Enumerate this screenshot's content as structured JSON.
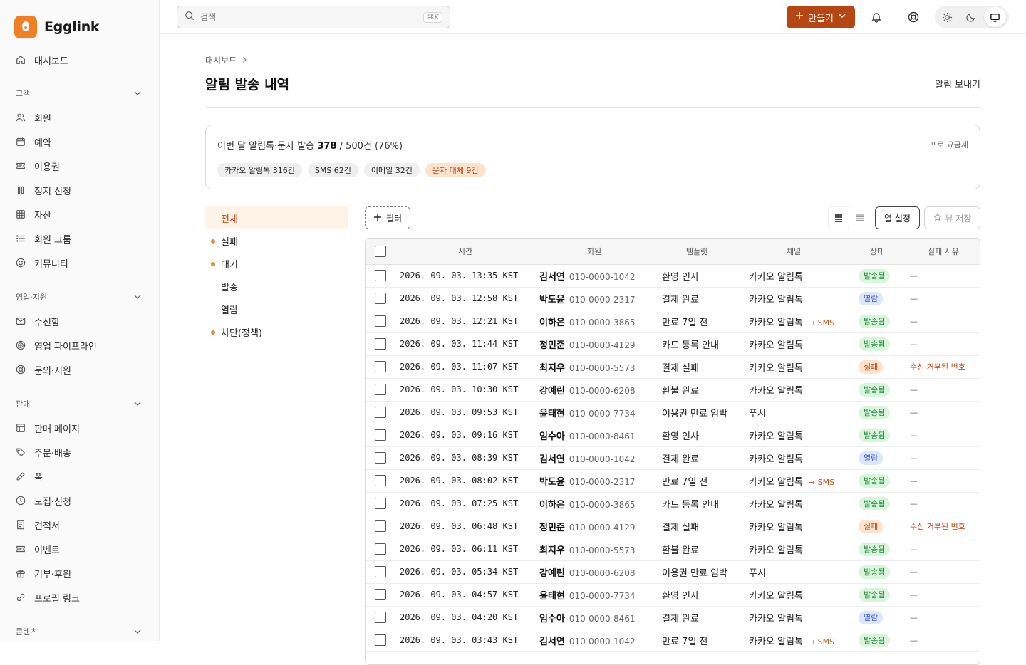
{
  "brand": {
    "name": "Egglink"
  },
  "sidebar": {
    "dashboard": "대시보드",
    "sections": [
      {
        "title": "고객",
        "items": [
          "회원",
          "예약",
          "이용권",
          "정지 신청",
          "자산",
          "회원 그룹",
          "커뮤니티"
        ]
      },
      {
        "title": "영업·지원",
        "items": [
          "수신함",
          "영업 파이프라인",
          "문의·지원"
        ]
      },
      {
        "title": "판매",
        "items": [
          "판매 페이지",
          "주문·배송",
          "폼",
          "모집·신청",
          "견적서",
          "이벤트",
          "기부·후원",
          "프로필 링크"
        ]
      },
      {
        "title": "콘텐츠",
        "items": []
      }
    ]
  },
  "topbar": {
    "search_placeholder": "검색",
    "search_shortcut": "⌘K",
    "create_label": "만들기"
  },
  "page": {
    "breadcrumb": "대시보드",
    "title": "알림 발송 내역",
    "send_link": "알림 보내기"
  },
  "quota": {
    "prefix": "이번 달 알림톡·문자 발송",
    "used": "378",
    "rest": "/ 500건 (76%)",
    "plan": "프로 요금제",
    "chips": [
      {
        "label": "카카오 알림톡 316건",
        "warn": false
      },
      {
        "label": "SMS 62건",
        "warn": false
      },
      {
        "label": "이메일 32건",
        "warn": false
      },
      {
        "label": "문자 대체 9건",
        "warn": true
      }
    ]
  },
  "filters": [
    {
      "label": "전체",
      "active": true,
      "dot": false
    },
    {
      "label": "실패",
      "active": false,
      "dot": true
    },
    {
      "label": "대기",
      "active": false,
      "dot": true
    },
    {
      "label": "발송",
      "active": false,
      "dot": false
    },
    {
      "label": "열람",
      "active": false,
      "dot": false
    },
    {
      "label": "차단(정책)",
      "active": false,
      "dot": true
    }
  ],
  "toolbar": {
    "filter_label": "필터",
    "columns_label": "열 설정",
    "save_view_label": "뷰 저장"
  },
  "table": {
    "headers": {
      "time": "시간",
      "member": "회원",
      "template": "템플릿",
      "channel": "채널",
      "status": "상태",
      "reason": "실패 사유"
    },
    "rows": [
      {
        "time": "2026. 09. 03. 13:35 KST",
        "name": "김서연",
        "phone": "010-0000-1042",
        "template": "환영 인사",
        "channel": "카카오 알림톡",
        "fallback": "",
        "status": "발송됨",
        "status_type": "sent",
        "reason": "—"
      },
      {
        "time": "2026. 09. 03. 12:58 KST",
        "name": "박도윤",
        "phone": "010-0000-2317",
        "template": "결제 완료",
        "channel": "카카오 알림톡",
        "fallback": "",
        "status": "열람",
        "status_type": "open",
        "reason": "—"
      },
      {
        "time": "2026. 09. 03. 12:21 KST",
        "name": "이하은",
        "phone": "010-0000-3865",
        "template": "만료 7일 전",
        "channel": "카카오 알림톡",
        "fallback": "→ SMS",
        "status": "발송됨",
        "status_type": "sent",
        "reason": "—"
      },
      {
        "time": "2026. 09. 03. 11:44 KST",
        "name": "정민준",
        "phone": "010-0000-4129",
        "template": "카드 등록 안내",
        "channel": "카카오 알림톡",
        "fallback": "",
        "status": "발송됨",
        "status_type": "sent",
        "reason": "—"
      },
      {
        "time": "2026. 09. 03. 11:07 KST",
        "name": "최지우",
        "phone": "010-0000-5573",
        "template": "결제 실패",
        "channel": "카카오 알림톡",
        "fallback": "",
        "status": "실패",
        "status_type": "fail",
        "reason": "수신 거부된 번호"
      },
      {
        "time": "2026. 09. 03. 10:30 KST",
        "name": "강예린",
        "phone": "010-0000-6208",
        "template": "환불 완료",
        "channel": "카카오 알림톡",
        "fallback": "",
        "status": "발송됨",
        "status_type": "sent",
        "reason": "—"
      },
      {
        "time": "2026. 09. 03. 09:53 KST",
        "name": "윤태현",
        "phone": "010-0000-7734",
        "template": "이용권 만료 임박",
        "channel": "푸시",
        "fallback": "",
        "status": "발송됨",
        "status_type": "sent",
        "reason": "—"
      },
      {
        "time": "2026. 09. 03. 09:16 KST",
        "name": "임수아",
        "phone": "010-0000-8461",
        "template": "환영 인사",
        "channel": "카카오 알림톡",
        "fallback": "",
        "status": "발송됨",
        "status_type": "sent",
        "reason": "—"
      },
      {
        "time": "2026. 09. 03. 08:39 KST",
        "name": "김서연",
        "phone": "010-0000-1042",
        "template": "결제 완료",
        "channel": "카카오 알림톡",
        "fallback": "",
        "status": "열람",
        "status_type": "open",
        "reason": "—"
      },
      {
        "time": "2026. 09. 03. 08:02 KST",
        "name": "박도윤",
        "phone": "010-0000-2317",
        "template": "만료 7일 전",
        "channel": "카카오 알림톡",
        "fallback": "→ SMS",
        "status": "발송됨",
        "status_type": "sent",
        "reason": "—"
      },
      {
        "time": "2026. 09. 03. 07:25 KST",
        "name": "이하은",
        "phone": "010-0000-3865",
        "template": "카드 등록 안내",
        "channel": "카카오 알림톡",
        "fallback": "",
        "status": "발송됨",
        "status_type": "sent",
        "reason": "—"
      },
      {
        "time": "2026. 09. 03. 06:48 KST",
        "name": "정민준",
        "phone": "010-0000-4129",
        "template": "결제 실패",
        "channel": "카카오 알림톡",
        "fallback": "",
        "status": "실패",
        "status_type": "fail",
        "reason": "수신 거부된 번호"
      },
      {
        "time": "2026. 09. 03. 06:11 KST",
        "name": "최지우",
        "phone": "010-0000-5573",
        "template": "환불 완료",
        "channel": "카카오 알림톡",
        "fallback": "",
        "status": "발송됨",
        "status_type": "sent",
        "reason": "—"
      },
      {
        "time": "2026. 09. 03. 05:34 KST",
        "name": "강예린",
        "phone": "010-0000-6208",
        "template": "이용권 만료 임박",
        "channel": "푸시",
        "fallback": "",
        "status": "발송됨",
        "status_type": "sent",
        "reason": "—"
      },
      {
        "time": "2026. 09. 03. 04:57 KST",
        "name": "윤태현",
        "phone": "010-0000-7734",
        "template": "환영 인사",
        "channel": "카카오 알림톡",
        "fallback": "",
        "status": "발송됨",
        "status_type": "sent",
        "reason": "—"
      },
      {
        "time": "2026. 09. 03. 04:20 KST",
        "name": "임수아",
        "phone": "010-0000-8461",
        "template": "결제 완료",
        "channel": "카카오 알림톡",
        "fallback": "",
        "status": "열람",
        "status_type": "open",
        "reason": "—"
      },
      {
        "time": "2026. 09. 03. 03:43 KST",
        "name": "김서연",
        "phone": "010-0000-1042",
        "template": "만료 7일 전",
        "channel": "카카오 알림톡",
        "fallback": "→ SMS",
        "status": "발송됨",
        "status_type": "sent",
        "reason": "—"
      }
    ]
  }
}
